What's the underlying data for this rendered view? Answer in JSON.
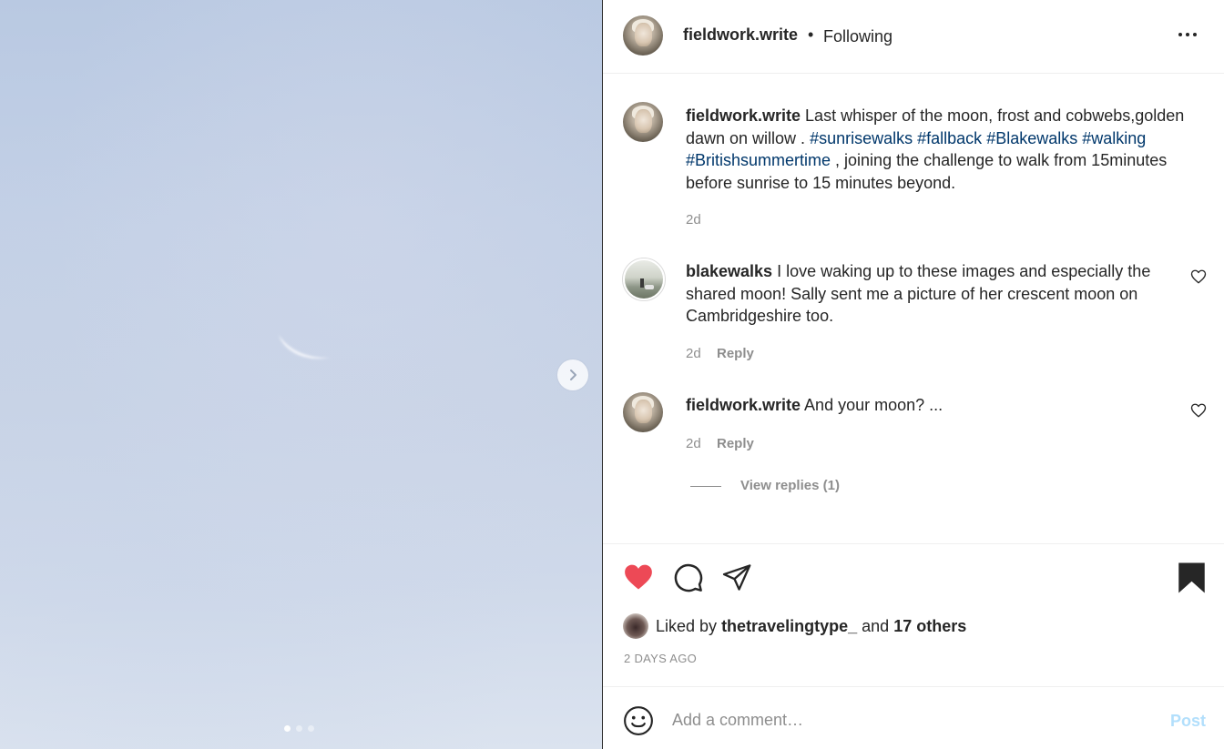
{
  "media": {
    "next_icon": "chevron-right-icon",
    "slide_count": 3,
    "active_slide": 1
  },
  "header": {
    "username": "fieldwork.write",
    "separator": "•",
    "follow_status": "Following",
    "more_icon": "more-horizontal-icon"
  },
  "caption": {
    "username": "fieldwork.write",
    "text_1": "Last whisper of the moon, frost and cobwebs,golden dawn on willow . ",
    "hashtags_1": [
      "#sunrisewalks",
      "#fallback",
      "#Blakewalks",
      "#walking",
      "#Britishsummertime"
    ],
    "text_2": " , joining the challenge to walk from 15minutes before sunrise to 15 minutes beyond.",
    "time": "2d"
  },
  "comments": [
    {
      "username": "blakewalks",
      "text": "I love waking up to these images and especially the shared moon! Sally sent me a picture of her crescent moon on Cambridgeshire too.",
      "time": "2d",
      "reply_label": "Reply"
    },
    {
      "username": "fieldwork.write",
      "text": "And your moon? ...",
      "time": "2d",
      "reply_label": "Reply",
      "view_replies": "View replies (1)"
    }
  ],
  "actions": {
    "like_icon": "heart-filled-icon",
    "comment_icon": "comment-icon",
    "share_icon": "paper-plane-icon",
    "save_icon": "bookmark-filled-icon",
    "liked_by_prefix": "Liked by",
    "liked_by_user": "thetravelingtype_",
    "liked_by_and": "and",
    "liked_by_others": "17 others",
    "timestamp": "2 DAYS AGO"
  },
  "comment_bar": {
    "emoji_icon": "smiley-icon",
    "placeholder": "Add a comment…",
    "post_label": "Post"
  },
  "colors": {
    "like_red": "#ed4956",
    "hashtag_blue": "#00376b",
    "post_disabled": "#b2dffc",
    "muted": "#8e8e8e"
  }
}
